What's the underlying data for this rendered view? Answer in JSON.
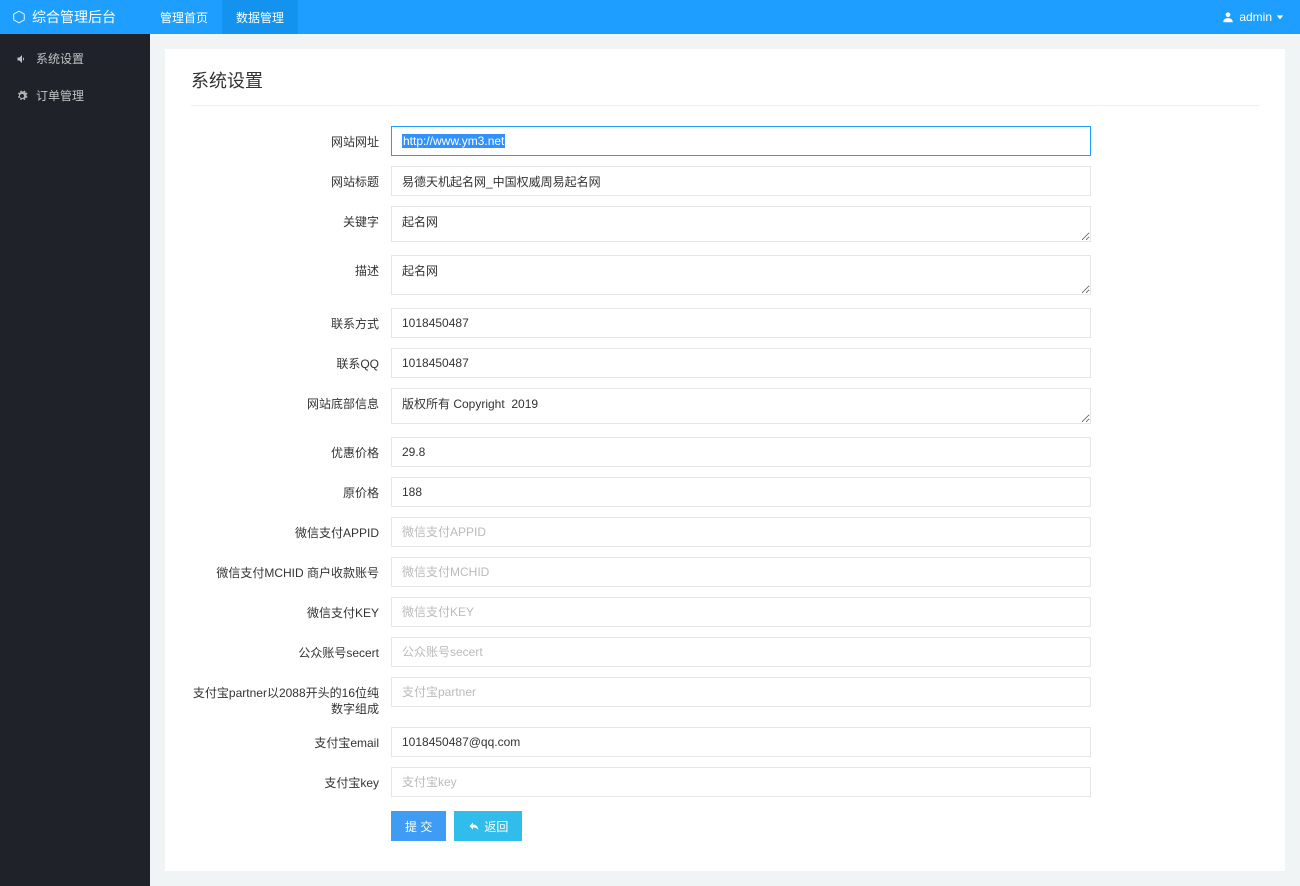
{
  "header": {
    "brand": "综合管理后台",
    "nav": [
      "管理首页",
      "数据管理"
    ],
    "user": "admin"
  },
  "sidebar": {
    "items": [
      {
        "label": "系统设置"
      },
      {
        "label": "订单管理"
      }
    ]
  },
  "page": {
    "title": "系统设置"
  },
  "form": {
    "fields": {
      "site_url": {
        "label": "网站网址",
        "value": "http://www.ym3.net"
      },
      "site_title": {
        "label": "网站标题",
        "value": "易德天机起名网_中国权威周易起名网"
      },
      "keywords": {
        "label": "关键字",
        "value": "起名网"
      },
      "description": {
        "label": "描述",
        "value": "起名网"
      },
      "contact": {
        "label": "联系方式",
        "value": "1018450487"
      },
      "qq": {
        "label": "联系QQ",
        "value": "1018450487"
      },
      "footer": {
        "label": "网站底部信息",
        "value": "版权所有 Copyright  2019"
      },
      "price_discount": {
        "label": "优惠价格",
        "value": "29.8"
      },
      "price_original": {
        "label": "原价格",
        "value": "188"
      },
      "wx_appid": {
        "label": "微信支付APPID",
        "placeholder": "微信支付APPID",
        "value": ""
      },
      "wx_mchid": {
        "label": "微信支付MCHID 商户收款账号",
        "placeholder": "微信支付MCHID",
        "value": ""
      },
      "wx_key": {
        "label": "微信支付KEY",
        "placeholder": "微信支付KEY",
        "value": ""
      },
      "wx_secret": {
        "label": "公众账号secert",
        "placeholder": "公众账号secert",
        "value": ""
      },
      "alipay_partner": {
        "label": "支付宝partner以2088开头的16位纯数字组成",
        "placeholder": "支付宝partner",
        "value": ""
      },
      "alipay_email": {
        "label": "支付宝email",
        "value": "1018450487@qq.com"
      },
      "alipay_key": {
        "label": "支付宝key",
        "placeholder": "支付宝key",
        "value": ""
      }
    },
    "buttons": {
      "submit": "提 交",
      "back": "返回"
    }
  }
}
